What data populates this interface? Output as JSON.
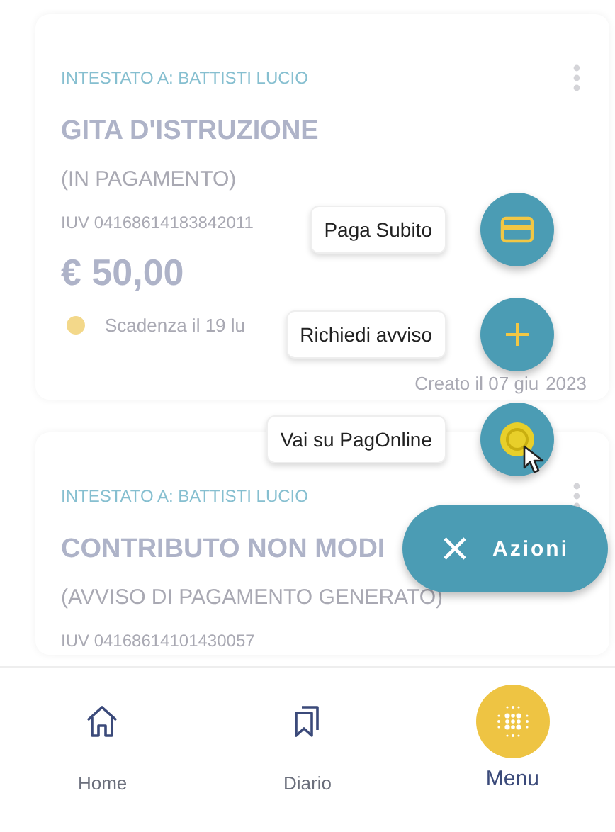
{
  "cards": [
    {
      "holder": "INTESTATO A: BATTISTI LUCIO",
      "title": "GITA D'ISTRUZIONE",
      "status": "(IN PAGAMENTO)",
      "iuv": "IUV 04168614183842011",
      "amount": "€ 50,00",
      "deadline": "Scadenza il 19 lu",
      "created_start": "Creato il 07 giu",
      "created_end": "2023"
    },
    {
      "holder": "INTESTATO A: BATTISTI LUCIO",
      "title": "CONTRIBUTO NON MODI",
      "status": "(AVVISO DI PAGAMENTO GENERATO)",
      "iuv": "IUV 04168614101430057"
    }
  ],
  "actions": [
    {
      "label": "Paga Subito",
      "kind": "card"
    },
    {
      "label": "Richiedi avviso",
      "kind": "plus"
    },
    {
      "label": "Vai su PagOnline",
      "kind": "coin"
    }
  ],
  "main_action": {
    "label": "Azioni"
  },
  "nav": [
    {
      "label": "Home",
      "kind": "home",
      "selected": false
    },
    {
      "label": "Diario",
      "kind": "bookmarks",
      "selected": false
    },
    {
      "label": "Menu",
      "kind": "grid",
      "selected": true
    }
  ]
}
